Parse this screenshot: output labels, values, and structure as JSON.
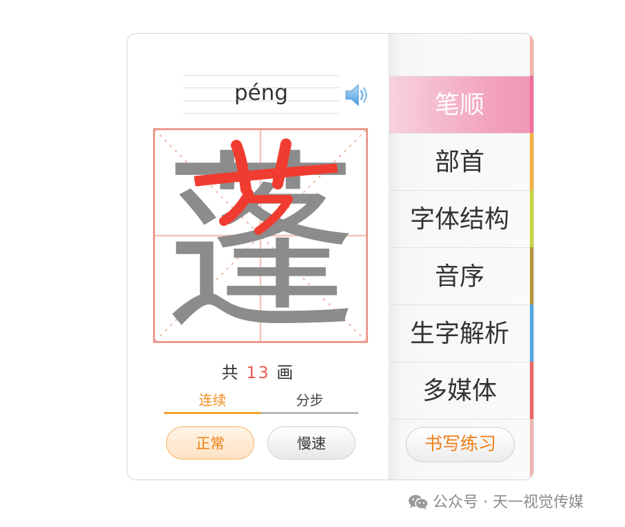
{
  "pinyin": "péng",
  "character": "蓬",
  "stroke_count": {
    "prefix": "共",
    "number": "13",
    "suffix": "画"
  },
  "mode_tabs": {
    "continuous": "连续",
    "step": "分步",
    "active": "连续"
  },
  "speed_buttons": {
    "normal": "正常",
    "slow": "慢速",
    "active": "正常"
  },
  "nav": {
    "items": [
      {
        "label": "笔顺",
        "color": "#f06c9b",
        "active": true
      },
      {
        "label": "部首",
        "color": "#f8ad3c",
        "active": false
      },
      {
        "label": "字体结构",
        "color": "#c4d43d",
        "active": false
      },
      {
        "label": "音序",
        "color": "#b4933c",
        "active": false
      },
      {
        "label": "生字解析",
        "color": "#4fa6e1",
        "active": false
      },
      {
        "label": "多媒体",
        "color": "#ec6464",
        "active": false
      }
    ],
    "practice_label": "书写练习"
  },
  "colors": {
    "accent_orange": "#f08a17",
    "grid_border": "#ec9a8f",
    "stroke_highlight": "#f03c30",
    "stroke_gray": "#8c8c8c",
    "count_number": "#e75c52"
  },
  "icons": {
    "speaker": "speaker-icon",
    "wechat": "wechat-icon"
  },
  "watermark": "公众号 · 天一视觉传媒"
}
